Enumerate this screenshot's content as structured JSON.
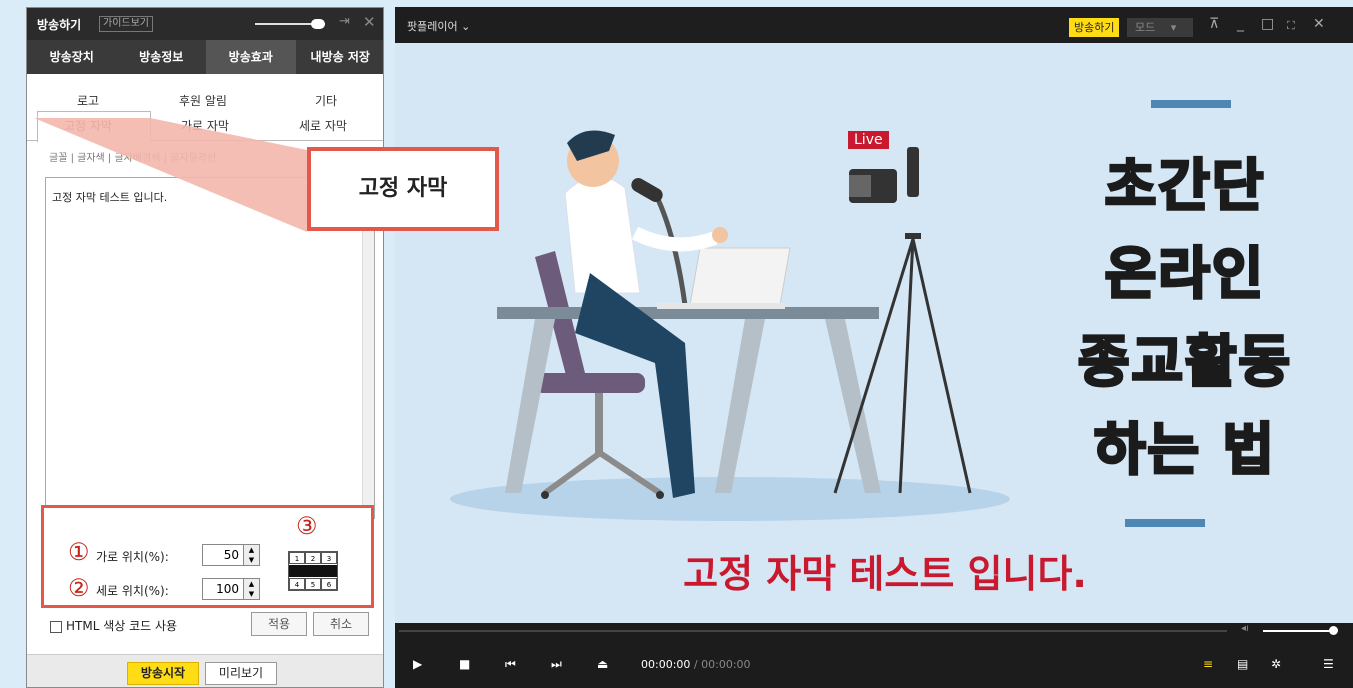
{
  "left_panel": {
    "title": "방송하기",
    "guide_label": "가이드보기",
    "pin_icon": "pin-icon",
    "close_symbol": "✕",
    "main_tabs": [
      "방송장치",
      "방송정보",
      "방송효과",
      "내방송 저장"
    ],
    "active_main_tab": "방송효과",
    "sub_tabs_row1": [
      "로고",
      "후원 알림",
      "기타"
    ],
    "sub_tabs_row2": [
      "고정 자막",
      "가로 자막",
      "세로 자막"
    ],
    "active_sub_tab": "고정 자막",
    "font_tabs": "글꼴 | 글자색 | 글자배경색 | 글자윤곽선",
    "caption_text": "고정 자막 테스트 입니다.",
    "horizontal_position": {
      "marker": "①",
      "label": "가로 위치(%):",
      "value": "50"
    },
    "vertical_position": {
      "marker": "②",
      "label": "세로 위치(%):",
      "value": "100"
    },
    "grid_marker": "③",
    "grid_top": [
      "1",
      "2",
      "3"
    ],
    "grid_bottom": [
      "4",
      "5",
      "6"
    ],
    "html_color_label": "HTML 색상 코드 사용",
    "apply_label": "적용",
    "cancel_label": "취소",
    "start_label": "방송시작",
    "preview_label": "미리보기"
  },
  "callout": {
    "text": "고정 자막"
  },
  "player": {
    "title": "팟플레이어",
    "dropdown_symbol": "⌄",
    "broadcast_label": "방송하기",
    "mode_label": "모드",
    "video": {
      "live_label": "Live",
      "headline_lines": [
        "초간단",
        "온라인",
        "종교활동",
        "하는 법"
      ],
      "subtitle": "고정 자막 테스트 입니다."
    },
    "time_current": "00:00:00",
    "time_separator": "/",
    "time_total": "00:00:00",
    "volume_level": 0.9
  },
  "colors": {
    "accent_yellow": "#ffdc14",
    "callout_red": "#e2584a",
    "subtitle_red": "#c8192f",
    "video_bg": "#d5e7f5"
  }
}
